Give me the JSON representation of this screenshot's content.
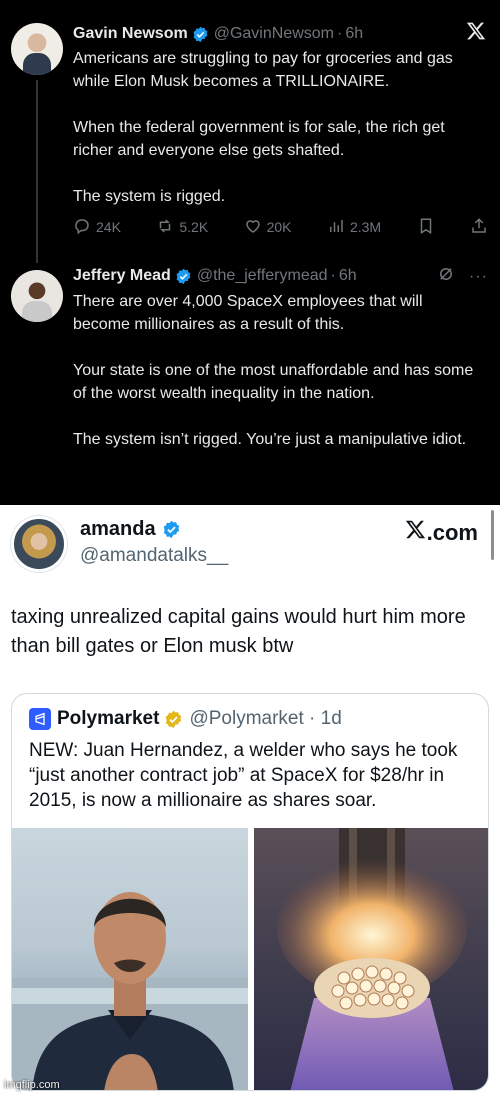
{
  "tweet_gavin": {
    "name": "Gavin Newsom",
    "handle": "@GavinNewsom",
    "time": "6h",
    "paragraphs": [
      "Americans are struggling to pay for groceries and gas while Elon Musk becomes a TRILLIONAIRE.",
      "When the federal government is for sale, the rich get richer and everyone else gets shafted.",
      "The system is rigged."
    ],
    "replies": "24K",
    "reposts": "5.2K",
    "likes": "20K",
    "views": "2.3M"
  },
  "tweet_jeffery": {
    "name": "Jeffery Mead",
    "handle": "@the_jefferymead",
    "time": "6h",
    "paragraphs": [
      "There are over 4,000 SpaceX employees that will become millionaires as a result of this.",
      "Your state is one of the most unaffordable and has some of the worst wealth inequality in the nation.",
      "The system isn’t rigged. You’re just a manipulative idiot."
    ]
  },
  "tweet_amanda": {
    "name": "amanda",
    "handle": "@amandatalks__",
    "source": ".com",
    "text": "taxing unrealized capital gains would hurt him more than bill gates or Elon musk btw"
  },
  "quote": {
    "name": "Polymarket",
    "handle": "@Polymarket",
    "time": "1d",
    "text": "NEW: Juan Hernandez, a welder who says he took “just another contract job” at SpaceX for $28/hr in 2015, is now a millionaire as shares soar."
  },
  "watermark": "imgflip.com",
  "colors": {
    "dark_bg": "#000000",
    "text_dark": "#e7e9ea",
    "muted": "#71767b",
    "verified_blue": "#1d9bf0",
    "verified_gold": "#e2b719"
  }
}
